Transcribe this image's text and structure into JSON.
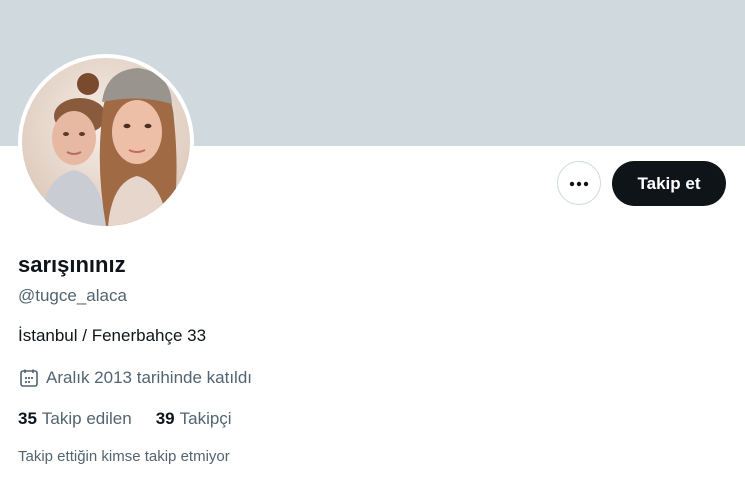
{
  "profile": {
    "display_name": "sarışınınız",
    "handle": "@tugce_alaca",
    "bio": "İstanbul / Fenerbahçe 33",
    "joined": "Aralık 2013 tarihinde katıldı",
    "following_count": "35",
    "following_label": "Takip edilen",
    "followers_count": "39",
    "followers_label": "Takipçi",
    "mutual_note": "Takip ettiğin kimse takip etmiyor"
  },
  "actions": {
    "follow_label": "Takip et",
    "more_icon": "more-dots-icon"
  },
  "icons": {
    "joined": "calendar-icon"
  },
  "colors": {
    "banner": "#cfd9de",
    "primary_text": "#0f1419",
    "secondary_text": "#536471",
    "follow_bg": "#0f1419"
  }
}
